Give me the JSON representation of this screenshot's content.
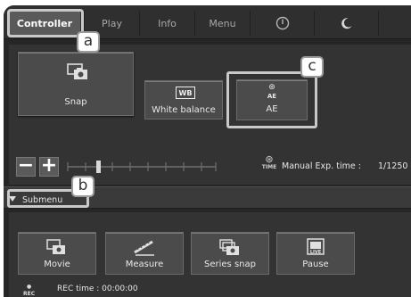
{
  "tabs": [
    {
      "label": "Controller",
      "active": true
    },
    {
      "label": "Play",
      "active": false
    },
    {
      "label": "Info",
      "active": false
    },
    {
      "label": "Menu",
      "active": false
    },
    {
      "label": "",
      "icon": "power-icon",
      "active": false
    },
    {
      "label": "",
      "icon": "moon-icon",
      "active": false
    }
  ],
  "controls": {
    "snap_label": "Snap",
    "wb_icon_text": "WB",
    "wb_label": "White balance",
    "ae_icon_text": "AE",
    "ae_label": "AE",
    "minus_label": "−",
    "plus_label": "+",
    "time_icon_text": "TIME",
    "exposure_label": "Manual Exp. time :",
    "exposure_value": "1/1250"
  },
  "submenu": {
    "label": "Submenu"
  },
  "lower_buttons": [
    {
      "label": "Movie",
      "icon": "movie-camera-icon"
    },
    {
      "label": "Measure",
      "icon": "ruler-icon"
    },
    {
      "label": "Series snap",
      "icon": "series-camera-icon"
    },
    {
      "label": "Pause",
      "icon": "live-pause-icon",
      "icon_text": "LIVE"
    }
  ],
  "rec": {
    "tag": "REC",
    "time_label": "REC time : 00:00:00"
  },
  "callouts": {
    "a": "a",
    "b": "b",
    "c": "c"
  },
  "colors": {
    "background": "#262626",
    "panel": "#333333",
    "button": "#4b4b4b",
    "highlight_frame": "#c9c9c9",
    "active_tab": "#5a5a5a"
  }
}
